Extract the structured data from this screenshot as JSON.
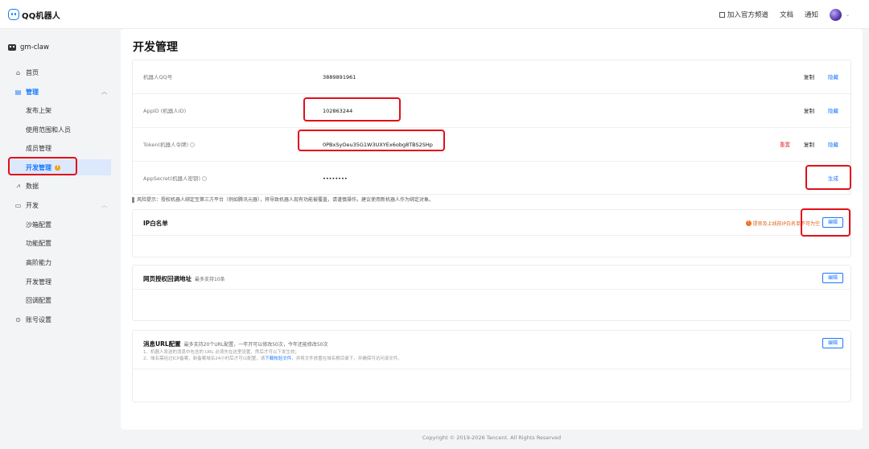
{
  "header": {
    "logo_text": "QQ机器人",
    "join_channel": "加入官方频道",
    "docs": "文档",
    "notifications": "通知"
  },
  "sidebar": {
    "bot_name": "gm-claw",
    "items": [
      {
        "label": "首页"
      },
      {
        "label": "管理"
      },
      {
        "label": "发布上架"
      },
      {
        "label": "使用范围和人员"
      },
      {
        "label": "成员管理"
      },
      {
        "label": "开发管理"
      },
      {
        "label": "数据"
      },
      {
        "label": "开发"
      },
      {
        "label": "沙箱配置"
      },
      {
        "label": "功能配置"
      },
      {
        "label": "高阶能力"
      },
      {
        "label": "开发管理"
      },
      {
        "label": "回调配置"
      },
      {
        "label": "账号设置"
      }
    ]
  },
  "main": {
    "title": "开发管理",
    "rows": [
      {
        "label": "机器人QQ号",
        "value": "3889891961",
        "copy": "复制",
        "hide": "隐藏"
      },
      {
        "label": "AppID (机器人ID)",
        "value": "102863244",
        "copy": "复制",
        "hide": "隐藏"
      },
      {
        "label": "Token(机器人令牌)",
        "value": "0PBxSyOeu35G1W3UXYEx6obg8TBS2SHp",
        "reset": "重置",
        "copy": "复制",
        "hide": "隐藏"
      },
      {
        "label": "AppSecret(机器人密钥)",
        "value": "••••••••",
        "generate": "生成"
      }
    ],
    "risk_notice": "风险提示：授权机器人绑定至第三方平台（例如腾讯元器），将导致机器人现有功能被覆盖，请谨慎操作。建议使用新机器人作为绑定对象。",
    "ip_whitelist": {
      "title": "IP白名单",
      "warning": "提审及上线前IP白名单不可为空",
      "edit": "编辑"
    },
    "web_auth": {
      "title": "网页授权回调地址",
      "subtitle": "最多支持10条",
      "edit": "编辑"
    },
    "message_url": {
      "title": "消息URL配置",
      "subtitle": "最多支持20个URL配置，一年开可以修改50次，今年还能修改50次",
      "note1": "1、机器人发送的消息中包含的 URL 必须先在这里设置，然后才可以下发生效；",
      "note2_prefix": "2、域名需经过ICP备案，新备案域名24小时后才可以配置，请",
      "note2_link": "下载校验文件",
      "note2_suffix": "，并将文件放置在域名根目录下，并确保可访问该文件。",
      "edit": "编辑"
    }
  },
  "footer": {
    "copyright": "Copyright © 2019-2026 Tencent. All Rights Reserved"
  },
  "colors": {
    "accent": "#1677ff",
    "danger": "#e0303a",
    "highlight_box": "#e0101a",
    "warning": "#f07020"
  }
}
